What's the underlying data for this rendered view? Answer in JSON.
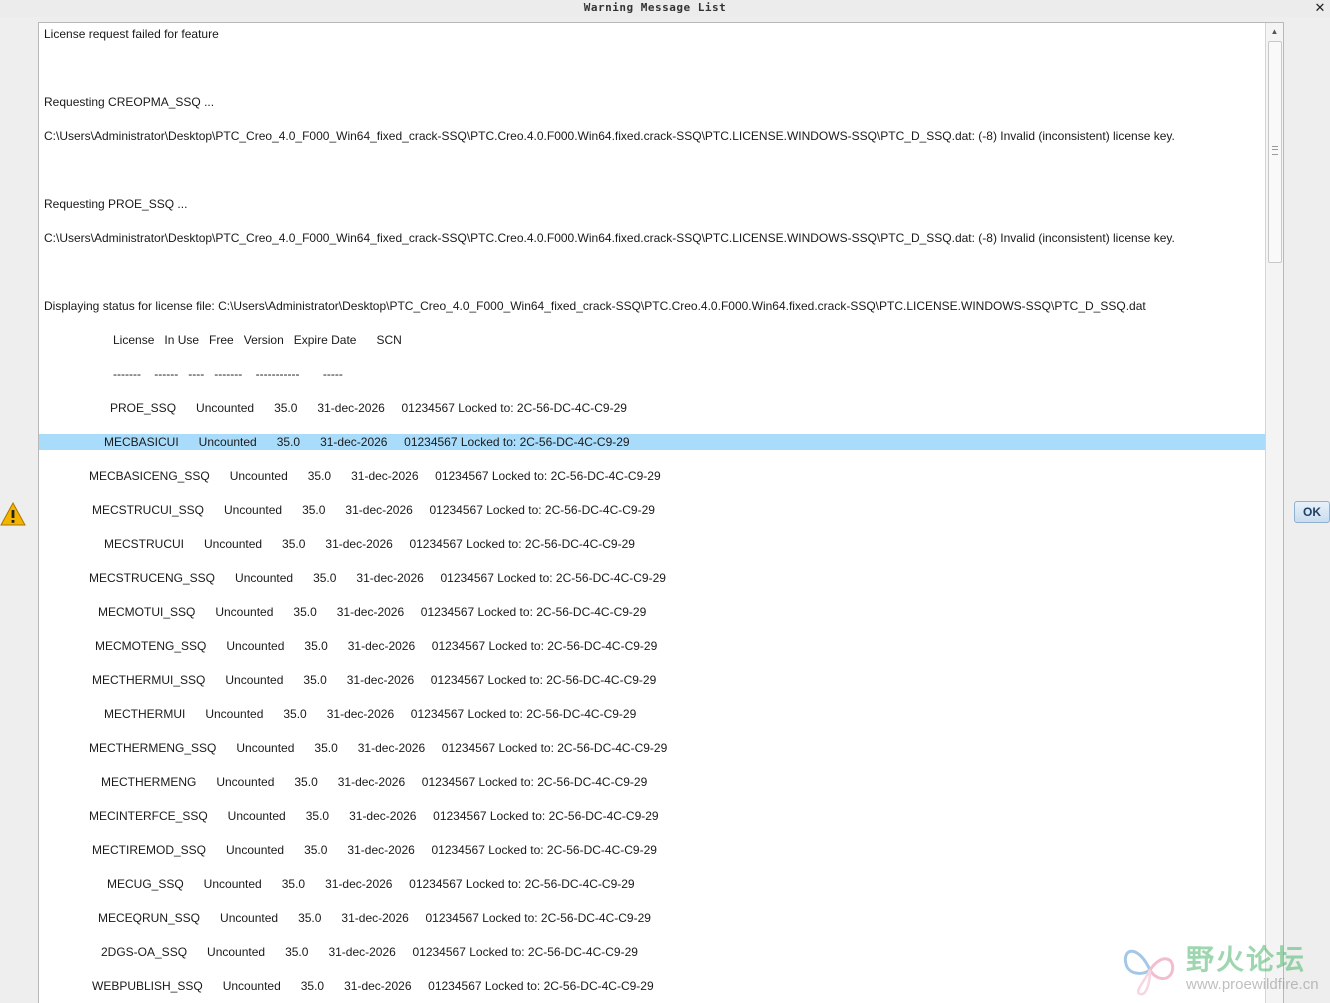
{
  "window": {
    "title": "Warning Message List",
    "close_glyph": "✕"
  },
  "lines": [
    {
      "text": "License request failed for feature",
      "indent": 0
    },
    {
      "text": "Requesting CREOPMA_SSQ ...",
      "indent": 0
    },
    {
      "text": "C:\\Users\\Administrator\\Desktop\\PTC_Creo_4.0_F000_Win64_fixed_crack-SSQ\\PTC.Creo.4.0.F000.Win64.fixed.crack-SSQ\\PTC.LICENSE.WINDOWS-SSQ\\PTC_D_SSQ.dat: (-8) Invalid (inconsistent) license key.",
      "indent": 0
    },
    {
      "text": "Requesting PROE_SSQ ...",
      "indent": 0
    },
    {
      "text": "C:\\Users\\Administrator\\Desktop\\PTC_Creo_4.0_F000_Win64_fixed_crack-SSQ\\PTC.Creo.4.0.F000.Win64.fixed.crack-SSQ\\PTC.LICENSE.WINDOWS-SSQ\\PTC_D_SSQ.dat: (-8) Invalid (inconsistent) license key.",
      "indent": 0
    },
    {
      "text": "Displaying status for license file: C:\\Users\\Administrator\\Desktop\\PTC_Creo_4.0_F000_Win64_fixed_crack-SSQ\\PTC.Creo.4.0.F000.Win64.fixed.crack-SSQ\\PTC.LICENSE.WINDOWS-SSQ\\PTC_D_SSQ.dat",
      "indent": 0
    },
    {
      "text": "License   In Use   Free   Version   Expire Date      SCN",
      "indent": 69
    },
    {
      "text": "-------    ------   ----   -------    -----------       -----",
      "indent": 69
    },
    {
      "text": "PROE_SSQ      Uncounted      35.0      31-dec-2026     01234567 Locked to: 2C-56-DC-4C-C9-29",
      "indent": 66
    },
    {
      "text": "MECBASICUI      Uncounted      35.0      31-dec-2026     01234567 Locked to: 2C-56-DC-4C-C9-29",
      "indent": 60,
      "selected": true
    },
    {
      "text": "MECBASICENG_SSQ      Uncounted      35.0      31-dec-2026     01234567 Locked to: 2C-56-DC-4C-C9-29",
      "indent": 45
    },
    {
      "text": "MECSTRUCUI_SSQ      Uncounted      35.0      31-dec-2026     01234567 Locked to: 2C-56-DC-4C-C9-29",
      "indent": 48
    },
    {
      "text": "MECSTRUCUI      Uncounted      35.0      31-dec-2026     01234567 Locked to: 2C-56-DC-4C-C9-29",
      "indent": 60
    },
    {
      "text": "MECSTRUCENG_SSQ      Uncounted      35.0      31-dec-2026     01234567 Locked to: 2C-56-DC-4C-C9-29",
      "indent": 45
    },
    {
      "text": "MECMOTUI_SSQ      Uncounted      35.0      31-dec-2026     01234567 Locked to: 2C-56-DC-4C-C9-29",
      "indent": 54
    },
    {
      "text": "MECMOTENG_SSQ      Uncounted      35.0      31-dec-2026     01234567 Locked to: 2C-56-DC-4C-C9-29",
      "indent": 51
    },
    {
      "text": "MECTHERMUI_SSQ      Uncounted      35.0      31-dec-2026     01234567 Locked to: 2C-56-DC-4C-C9-29",
      "indent": 48
    },
    {
      "text": "MECTHERMUI      Uncounted      35.0      31-dec-2026     01234567 Locked to: 2C-56-DC-4C-C9-29",
      "indent": 60
    },
    {
      "text": "MECTHERMENG_SSQ      Uncounted      35.0      31-dec-2026     01234567 Locked to: 2C-56-DC-4C-C9-29",
      "indent": 45
    },
    {
      "text": "MECTHERMENG      Uncounted      35.0      31-dec-2026     01234567 Locked to: 2C-56-DC-4C-C9-29",
      "indent": 57
    },
    {
      "text": "MECINTERFCE_SSQ      Uncounted      35.0      31-dec-2026     01234567 Locked to: 2C-56-DC-4C-C9-29",
      "indent": 45
    },
    {
      "text": "MECTIREMOD_SSQ      Uncounted      35.0      31-dec-2026     01234567 Locked to: 2C-56-DC-4C-C9-29",
      "indent": 48
    },
    {
      "text": "MECUG_SSQ      Uncounted      35.0      31-dec-2026     01234567 Locked to: 2C-56-DC-4C-C9-29",
      "indent": 63
    },
    {
      "text": "MECEQRUN_SSQ      Uncounted      35.0      31-dec-2026     01234567 Locked to: 2C-56-DC-4C-C9-29",
      "indent": 54
    },
    {
      "text": "2DGS-OA_SSQ      Uncounted      35.0      31-dec-2026     01234567 Locked to: 2C-56-DC-4C-C9-29",
      "indent": 57
    },
    {
      "text": "WEBPUBLISH_SSQ      Uncounted      35.0      31-dec-2026     01234567 Locked to: 2C-56-DC-4C-C9-29",
      "indent": 48
    }
  ],
  "line_rows": [
    0,
    2,
    3,
    5,
    6,
    8,
    9,
    10,
    11,
    12,
    13,
    14,
    15,
    16,
    17,
    18,
    19,
    20,
    21,
    22,
    23,
    24,
    25,
    26,
    27,
    28
  ],
  "buttons": {
    "ok_label": "OK"
  },
  "watermark": {
    "title": "野火论坛",
    "url": "www.proewildfire.cn"
  },
  "colors": {
    "selection": "#a9dcfb",
    "warning_icon": "#f5b400"
  }
}
